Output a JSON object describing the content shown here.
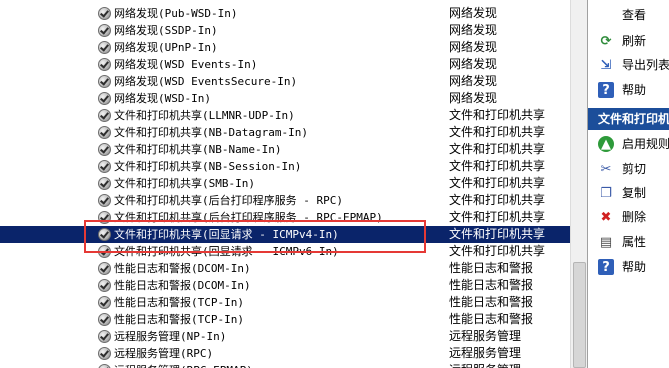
{
  "rules": [
    {
      "name": "网络发现(Pub-WSD-In)",
      "group": "网络发现"
    },
    {
      "name": "网络发现(SSDP-In)",
      "group": "网络发现"
    },
    {
      "name": "网络发现(UPnP-In)",
      "group": "网络发现"
    },
    {
      "name": "网络发现(WSD Events-In)",
      "group": "网络发现"
    },
    {
      "name": "网络发现(WSD EventsSecure-In)",
      "group": "网络发现"
    },
    {
      "name": "网络发现(WSD-In)",
      "group": "网络发现"
    },
    {
      "name": "文件和打印机共享(LLMNR-UDP-In)",
      "group": "文件和打印机共享"
    },
    {
      "name": "文件和打印机共享(NB-Datagram-In)",
      "group": "文件和打印机共享"
    },
    {
      "name": "文件和打印机共享(NB-Name-In)",
      "group": "文件和打印机共享"
    },
    {
      "name": "文件和打印机共享(NB-Session-In)",
      "group": "文件和打印机共享"
    },
    {
      "name": "文件和打印机共享(SMB-In)",
      "group": "文件和打印机共享"
    },
    {
      "name": "文件和打印机共享(后台打印程序服务 - RPC)",
      "group": "文件和打印机共享"
    },
    {
      "name": "文件和打印机共享(后台打印程序服务 - RPC-EPMAP)",
      "group": "文件和打印机共享"
    },
    {
      "name": "文件和打印机共享(回显请求 - ICMPv4-In)",
      "group": "文件和打印机共享",
      "selected": true
    },
    {
      "name": "文件和打印机共享(回显请求 - ICMPv6-In)",
      "group": "文件和打印机共享"
    },
    {
      "name": "性能日志和警报(DCOM-In)",
      "group": "性能日志和警报"
    },
    {
      "name": "性能日志和警报(DCOM-In)",
      "group": "性能日志和警报"
    },
    {
      "name": "性能日志和警报(TCP-In)",
      "group": "性能日志和警报"
    },
    {
      "name": "性能日志和警报(TCP-In)",
      "group": "性能日志和警报"
    },
    {
      "name": "远程服务管理(NP-In)",
      "group": "远程服务管理"
    },
    {
      "name": "远程服务管理(RPC)",
      "group": "远程服务管理"
    },
    {
      "name": "远程服务管理(RPC-EPMAP)",
      "group": "远程服务管理"
    }
  ],
  "actions": {
    "view": "查看",
    "refresh": "刷新",
    "export_list": "导出列表",
    "help_1": "帮助",
    "section_header": "文件和打印机共享",
    "enable_rule": "启用规则",
    "cut": "剪切",
    "copy": "复制",
    "delete": "删除",
    "properties": "属性",
    "help_2": "帮助"
  },
  "icons": {
    "rule_status": "check-circle-icon",
    "refresh": "refresh-icon",
    "export": "export-icon",
    "help": "help-icon",
    "enable": "enable-arrow-icon",
    "cut": "scissors-icon",
    "copy": "copy-icon",
    "delete": "delete-x-icon",
    "properties": "properties-icon"
  },
  "colors": {
    "selection": "#0a246a",
    "highlight_box": "#e53935",
    "section_header": "#1c4e9a"
  }
}
